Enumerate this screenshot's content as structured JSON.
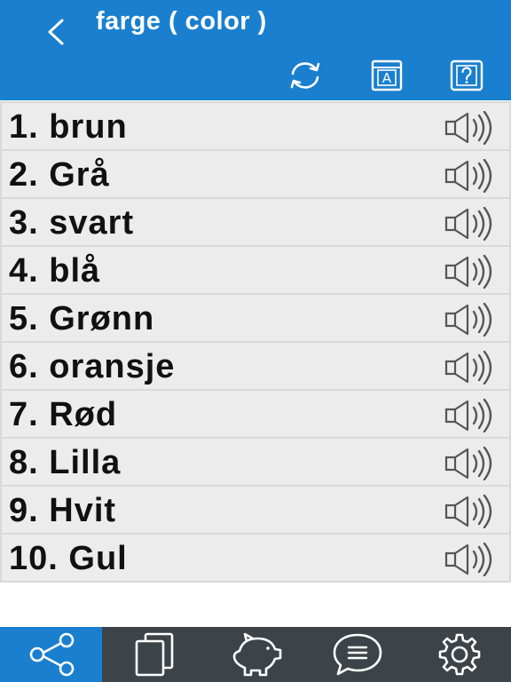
{
  "header": {
    "title": "farge ( color )",
    "accent_color": "#1a7fce",
    "back_icon": "chevron-left-icon",
    "tools": [
      {
        "name": "refresh-icon"
      },
      {
        "name": "dictionary-icon",
        "letter": "A"
      },
      {
        "name": "help-icon"
      }
    ]
  },
  "words": [
    {
      "label": "1. brun"
    },
    {
      "label": "2. Grå"
    },
    {
      "label": "3. svart"
    },
    {
      "label": "4. blå"
    },
    {
      "label": "5. Grønn"
    },
    {
      "label": "6. oransje"
    },
    {
      "label": "7. Rød"
    },
    {
      "label": "8. Lilla"
    },
    {
      "label": "9. Hvit"
    },
    {
      "label": "10. Gul"
    }
  ],
  "tabbar": {
    "background": "#3d4449",
    "active_tab": "share",
    "tabs": [
      {
        "name": "share-icon"
      },
      {
        "name": "cards-icon"
      },
      {
        "name": "piggy-bank-icon"
      },
      {
        "name": "chat-icon"
      },
      {
        "name": "settings-icon"
      }
    ]
  }
}
